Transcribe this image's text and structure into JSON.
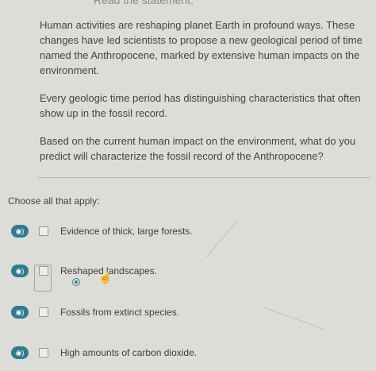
{
  "header": {
    "cut_text": "Read the statement."
  },
  "passage": {
    "p1": "Human activities are reshaping planet Earth in profound ways. These changes have led scientists to propose a new geological period of time named the Anthropocene, marked by extensive human impacts on the environment.",
    "p2": "Every geologic time period has distinguishing characteristics that often show up in the fossil record.",
    "p3": "Based on the current human impact on the environment, what do you predict will characterize the fossil record of the Anthropocene?"
  },
  "prompt": "Choose all that apply:",
  "options": [
    {
      "label": "Evidence of thick, large forests.",
      "checked": false
    },
    {
      "label": "Reshaped landscapes.",
      "checked": false
    },
    {
      "label": "Fossils from extinct species.",
      "checked": false
    },
    {
      "label": "High amounts of carbon dioxide.",
      "checked": false
    }
  ],
  "icons": {
    "audio": "speaker-person-icon",
    "cursor": "hand-pointer-icon",
    "selection": "target-dot-icon"
  },
  "colors": {
    "accent": "#2f7b8f",
    "background": "#dcdcd8"
  }
}
